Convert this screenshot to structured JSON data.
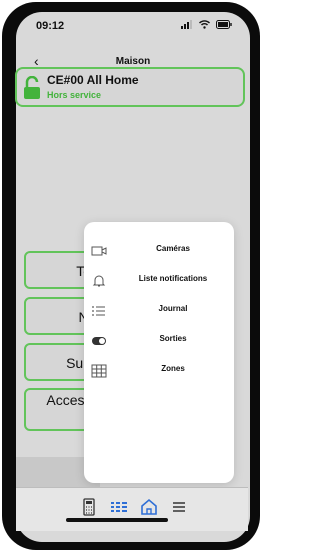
{
  "status_bar": {
    "time": "09:12",
    "signal_icon": "signal-icon",
    "wifi_icon": "wifi-icon",
    "battery_icon": "battery-icon"
  },
  "nav": {
    "back_icon": "chevron-left-icon",
    "title": "Maison"
  },
  "alarm": {
    "name": "CE#00 All Home",
    "status": "Hors service",
    "status_color": "#43b33c",
    "icon": "unlock-icon"
  },
  "modes": [
    {
      "label": "Total"
    },
    {
      "label": "Nuit"
    },
    {
      "label": "Sup. Bo"
    },
    {
      "label": "Acces Technic"
    }
  ],
  "menu": {
    "items": [
      {
        "label": "Caméras",
        "icon": "camera-icon"
      },
      {
        "label": "Liste notifications",
        "icon": "bell-icon"
      },
      {
        "label": "Journal",
        "icon": "list-icon"
      },
      {
        "label": "Sorties",
        "icon": "toggle-icon"
      },
      {
        "label": "Zones",
        "icon": "grid-icon"
      }
    ]
  },
  "tabbar": {
    "items": [
      {
        "icon": "keypad-icon"
      },
      {
        "icon": "device-list-icon"
      },
      {
        "icon": "home-icon",
        "active": true
      },
      {
        "icon": "menu-icon"
      }
    ],
    "accent": "#2f6fd6"
  }
}
